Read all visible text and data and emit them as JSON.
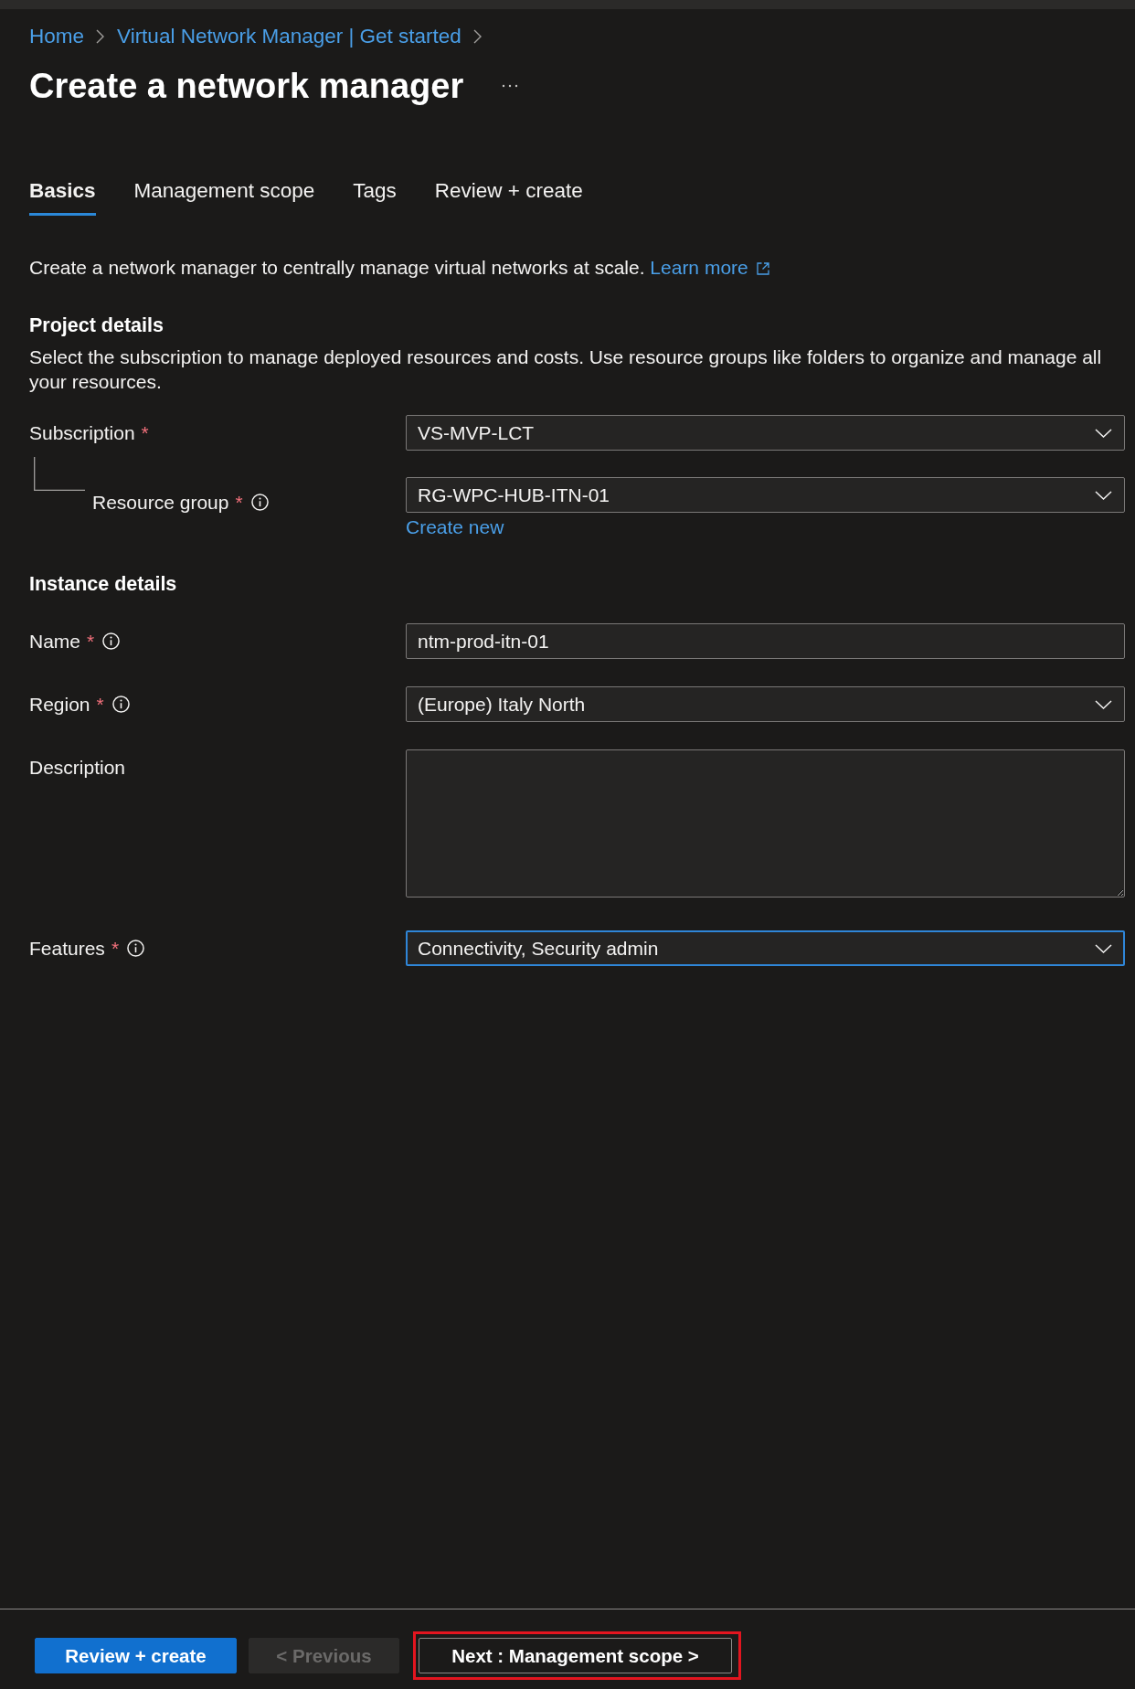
{
  "top_bar": {
    "breadcrumb": [
      {
        "label": "Home"
      },
      {
        "label": "Virtual Network Manager | Get started"
      }
    ]
  },
  "page": {
    "title": "Create a network manager"
  },
  "tabs": [
    {
      "label": "Basics",
      "selected": true
    },
    {
      "label": "Management scope",
      "selected": false
    },
    {
      "label": "Tags",
      "selected": false
    },
    {
      "label": "Review + create",
      "selected": false
    }
  ],
  "intro": {
    "text": "Create a network manager to centrally manage virtual networks at scale.",
    "link": "Learn more"
  },
  "sections": [
    {
      "heading": "Project details",
      "description": "Select the subscription to manage deployed resources and costs. Use resource groups like folders to organize and manage all your resources.",
      "fields": [
        {
          "kind": "dropdown",
          "label": "Subscription",
          "required_mark": "*",
          "info_icon": false,
          "value": "VS-MVP-LCT",
          "focused": false,
          "children": [
            {
              "kind": "dropdown",
              "label": "Resource group",
              "required_mark": "*",
              "info_icon": true,
              "value": "RG-WPC-HUB-ITN-01",
              "focused": false,
              "link": "Create new"
            }
          ]
        }
      ]
    },
    {
      "heading": "Instance details",
      "fields": [
        {
          "kind": "text",
          "label": "Name",
          "required_mark": "*",
          "info_icon": true,
          "value": "ntm-prod-itn-01",
          "focused": false
        },
        {
          "kind": "dropdown",
          "label": "Region",
          "required_mark": "*",
          "info_icon": true,
          "value": "(Europe) Italy North",
          "focused": false
        },
        {
          "kind": "textarea",
          "label": "Description",
          "info_icon": false,
          "focused": false
        },
        {
          "kind": "dropdown",
          "label": "Features",
          "required_mark": "*",
          "info_icon": true,
          "value": "Connectivity, Security admin",
          "focused": true
        }
      ]
    }
  ],
  "footer": {
    "buttons": [
      {
        "kind": "primary",
        "label": "Review + create",
        "disabled": false,
        "highlighted": false
      },
      {
        "kind": "secondary",
        "label": "< Previous",
        "disabled": true,
        "highlighted": false
      },
      {
        "kind": "secondary",
        "label": "Next : Management scope >",
        "disabled": false,
        "highlighted": true
      }
    ]
  }
}
